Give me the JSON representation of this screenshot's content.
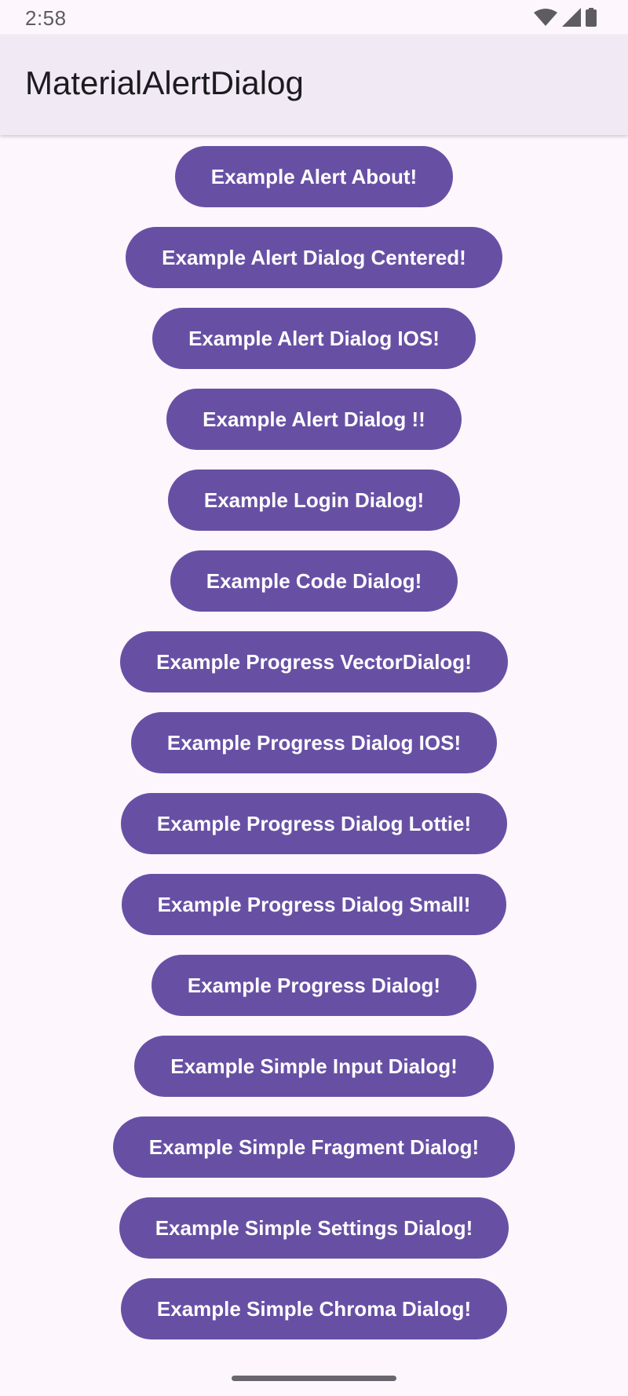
{
  "status_bar": {
    "time": "2:58",
    "icons": [
      "wifi-icon",
      "cell-signal-icon",
      "battery-icon"
    ]
  },
  "app_bar": {
    "title": "MaterialAlertDialog"
  },
  "buttons": [
    "Example Alert About!",
    "Example Alert Dialog Centered!",
    "Example Alert Dialog IOS!",
    "Example Alert Dialog !!",
    "Example Login Dialog!",
    "Example Code Dialog!",
    "Example Progress VectorDialog!",
    "Example Progress Dialog IOS!",
    "Example Progress Dialog Lottie!",
    "Example Progress Dialog Small!",
    "Example Progress Dialog!",
    "Example Simple Input Dialog!",
    "Example Simple Fragment Dialog!",
    "Example Simple Settings Dialog!",
    "Example Simple Chroma Dialog!"
  ],
  "colors": {
    "background": "#fdf7fd",
    "app_bar": "#f1eaf5",
    "button": "#6750a4",
    "button_text": "#ffffff"
  }
}
